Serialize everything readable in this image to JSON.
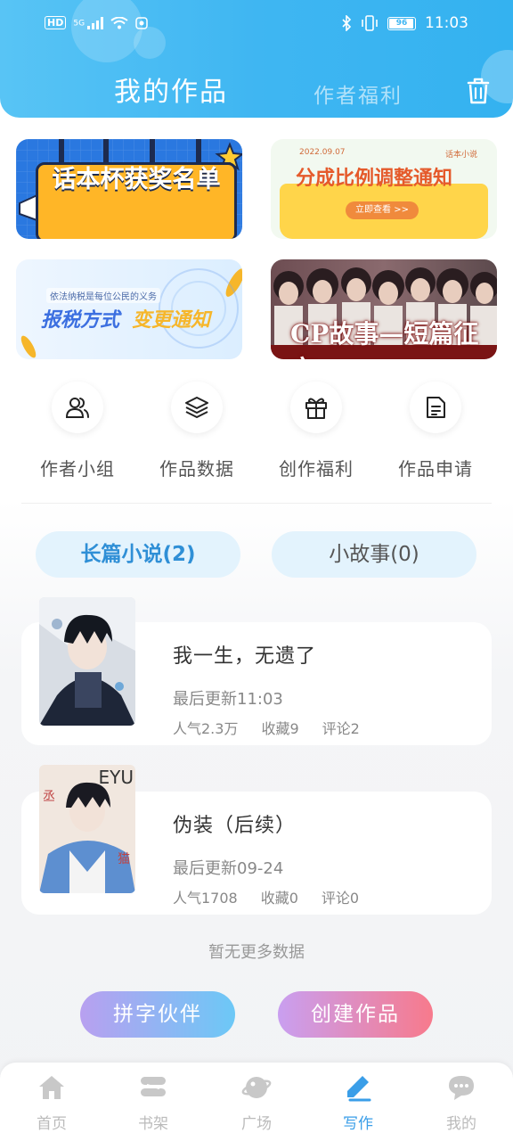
{
  "status_bar": {
    "network_badge": "HD",
    "signal_text": "5G",
    "battery": "96",
    "battery_fraction": 0.96,
    "time": "11:03"
  },
  "header": {
    "tab_active": "我的作品",
    "tab_inactive": "作者福利"
  },
  "banners": [
    {
      "text": "话本杯获奖名单"
    },
    {
      "date": "2022.09.07",
      "tag": "话本小说",
      "title": "分成比例调整通知",
      "button": "立即查看 >>"
    },
    {
      "subtitle": "依法纳税是每位公民的义务",
      "title_part1": "报税方式",
      "title_part2": "变更通知"
    },
    {
      "title": "CP故事—短篇征文"
    }
  ],
  "quick_actions": [
    {
      "label": "作者小组",
      "icon": "users-icon"
    },
    {
      "label": "作品数据",
      "icon": "layers-icon"
    },
    {
      "label": "创作福利",
      "icon": "gift-icon"
    },
    {
      "label": "作品申请",
      "icon": "document-icon"
    }
  ],
  "filter_tabs": {
    "novel": "长篇小说(2)",
    "story": "小故事(0)"
  },
  "works": [
    {
      "title": "我一生，无遗了",
      "update": "最后更新11:03",
      "popularity": "人气2.3万",
      "favorites": "收藏9",
      "comments": "评论2"
    },
    {
      "title": "伪装（后续）",
      "update": "最后更新09-24",
      "popularity": "人气1708",
      "favorites": "收藏0",
      "comments": "评论0"
    }
  ],
  "cover2_text": "EYU",
  "no_more": "暂无更多数据",
  "buttons": {
    "partner": "拼字伙伴",
    "create": "创建作品"
  },
  "nav": [
    {
      "label": "首页",
      "icon": "home-icon"
    },
    {
      "label": "书架",
      "icon": "bookshelf-icon"
    },
    {
      "label": "广场",
      "icon": "planet-icon"
    },
    {
      "label": "写作",
      "icon": "pen-icon",
      "active": true
    },
    {
      "label": "我的",
      "icon": "chat-bubble-icon"
    }
  ],
  "colors": {
    "header": "#3fb6f2",
    "active_nav": "#3a9ee8",
    "pill_bg": "#e3f3fd"
  }
}
